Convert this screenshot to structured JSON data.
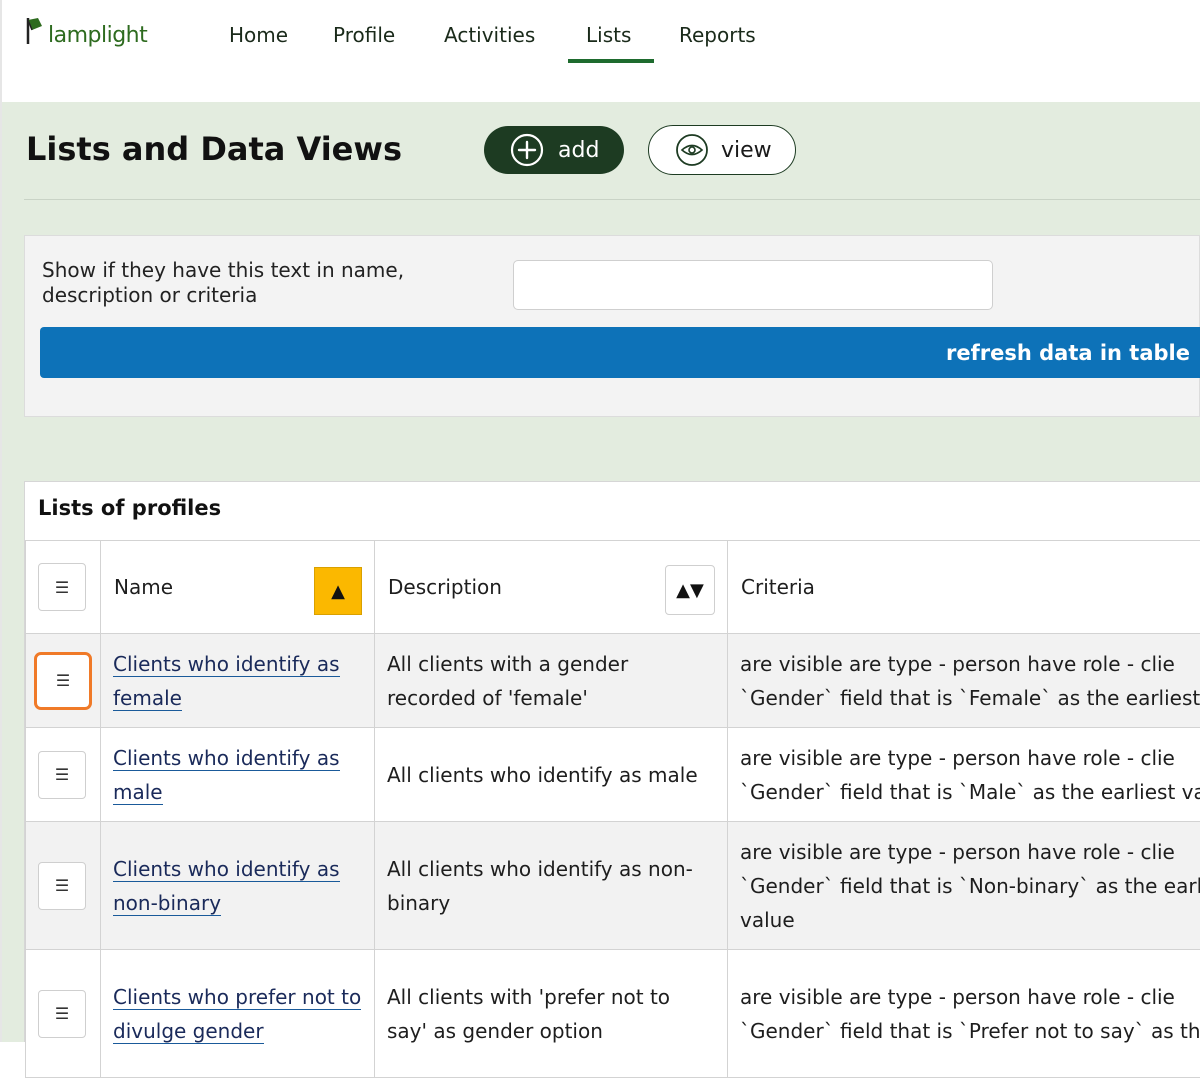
{
  "app": {
    "logo_text": "lamplight"
  },
  "nav": {
    "items": [
      "Home",
      "Profile",
      "Activities",
      "Lists",
      "Reports"
    ],
    "active": "Lists"
  },
  "page": {
    "title": "Lists and Data Views",
    "add_label": "add",
    "view_label": "view"
  },
  "filter": {
    "label": "Show if they have this text in name, description or criteria",
    "value": "",
    "refresh_label": "refresh data in table"
  },
  "table": {
    "caption": "Lists of profiles",
    "columns": {
      "name": "Name",
      "description": "Description",
      "criteria": "Criteria"
    },
    "menu_glyph": "☰",
    "sort_asc_glyph": "▲",
    "sort_both_glyph": "▲▼",
    "rows": [
      {
        "name": "Clients who identify as female",
        "description": "All clients with a gender recorded of 'female'",
        "criteria_1": "are visible are type - person have role - clie",
        "criteria_2": "`Gender` field that is `Female` as the earliest v",
        "criteria_3": ""
      },
      {
        "name": "Clients who identify as male",
        "description": "All clients who identify as male",
        "criteria_1": "are visible are type - person have role - clie",
        "criteria_2": "`Gender` field that is `Male` as the earliest val",
        "criteria_3": ""
      },
      {
        "name": "Clients who identify as non-binary",
        "description": "All clients who identify as non-binary",
        "criteria_1": "are visible are type - person have role - clie",
        "criteria_2": "`Gender` field that is `Non-binary` as the earli",
        "criteria_3": "value"
      },
      {
        "name": "Clients who prefer not to divulge gender",
        "description": "All clients with 'prefer not to say' as gender option",
        "criteria_1": "are visible are type - person have role - clie",
        "criteria_2": "`Gender` field that is `Prefer not to say` as the",
        "criteria_3": ""
      }
    ]
  },
  "colors": {
    "brand_dark_green": "#1d3b22",
    "content_bg": "#e3ecdf",
    "refresh_blue": "#0d72b8",
    "sort_active": "#fbb800",
    "focus_orange": "#f07a28"
  }
}
